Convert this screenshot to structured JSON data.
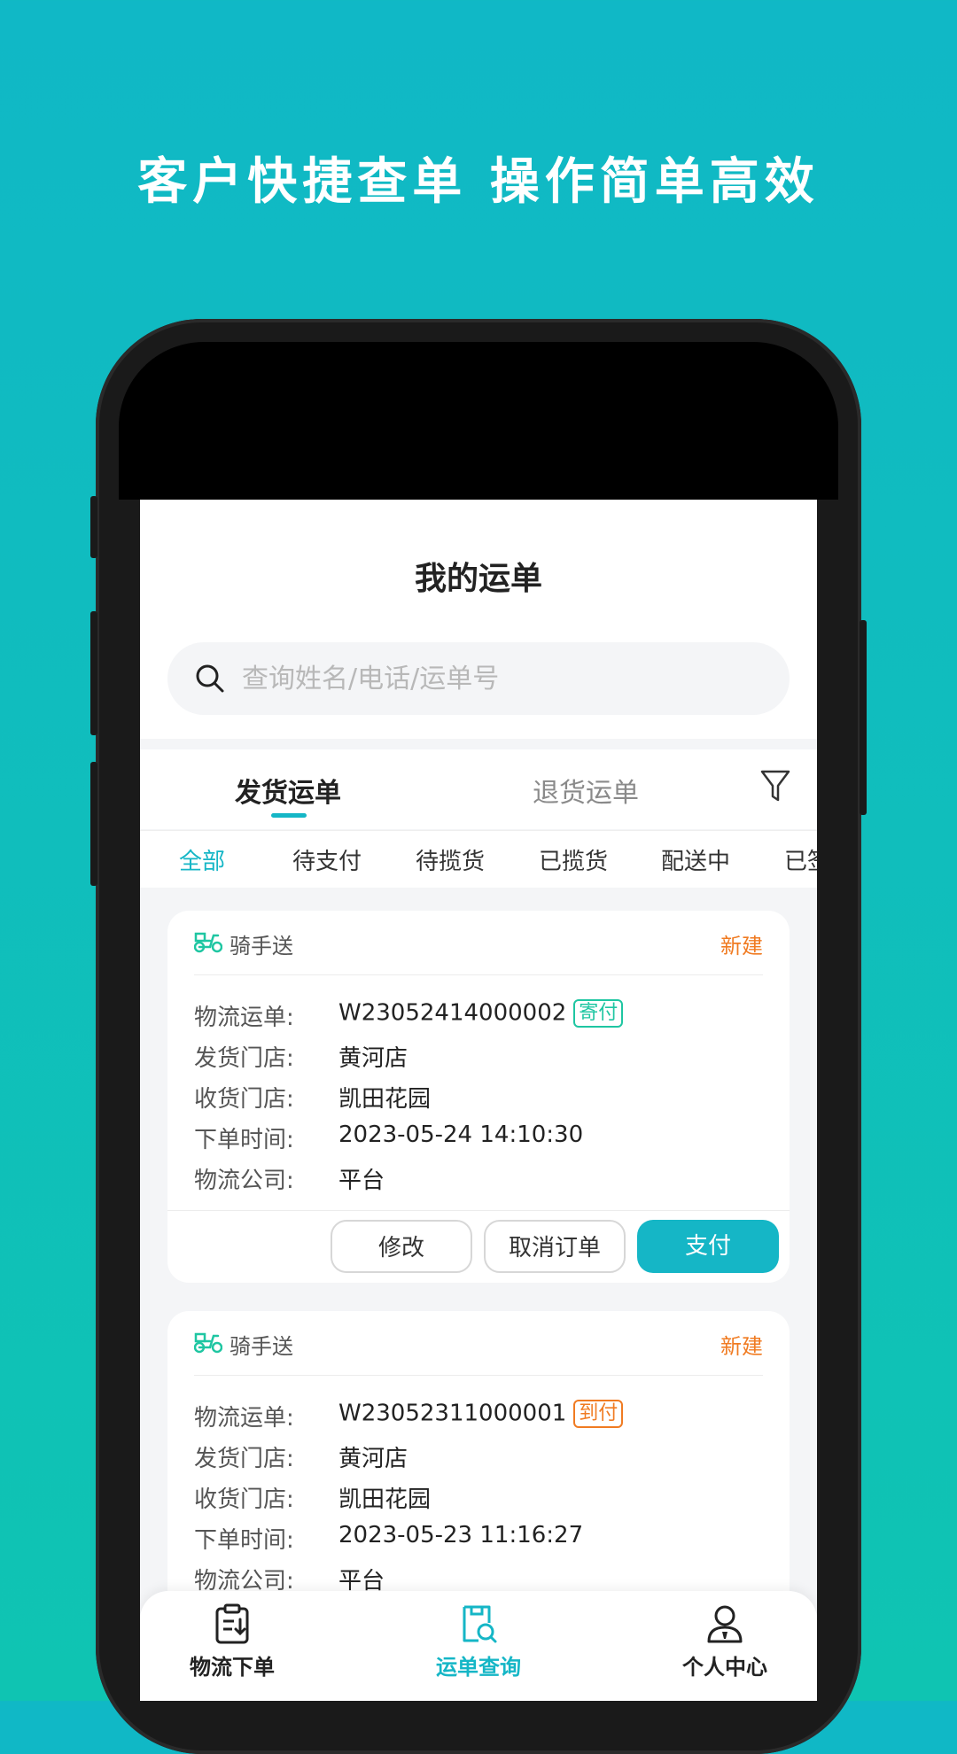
{
  "headline": "客户快捷查单 操作简单高效",
  "app": {
    "title": "我的运单",
    "search_placeholder": "查询姓名/电话/运单号"
  },
  "tabs": {
    "ship": "发货运单",
    "return": "退货运单"
  },
  "status_filters": [
    "全部",
    "待支付",
    "待揽货",
    "已揽货",
    "配送中",
    "已签"
  ],
  "labels": {
    "waybill": "物流运单:",
    "ship_store": "发货门店:",
    "receive_store": "收货门店:",
    "order_time": "下单时间:",
    "company": "物流公司:"
  },
  "orders": [
    {
      "service": "骑手送",
      "status": "新建",
      "waybill": "W23052414000002",
      "pay_type": "寄付",
      "ship_store": "黄河店",
      "receive_store": "凯田花园",
      "order_time": "2023-05-24 14:10:30",
      "company": "平台",
      "actions": {
        "modify": "修改",
        "cancel": "取消订单",
        "pay": "支付"
      }
    },
    {
      "service": "骑手送",
      "status": "新建",
      "waybill": "W23052311000001",
      "pay_type": "到付",
      "ship_store": "黄河店",
      "receive_store": "凯田花园",
      "order_time": "2023-05-23 11:16:27",
      "company": "平台"
    }
  ],
  "nav": [
    "物流下单",
    "运单查询",
    "个人中心"
  ],
  "colors": {
    "accent": "#15b6c6",
    "warning": "#f07b22",
    "badge_green": "#1fc6a2"
  }
}
